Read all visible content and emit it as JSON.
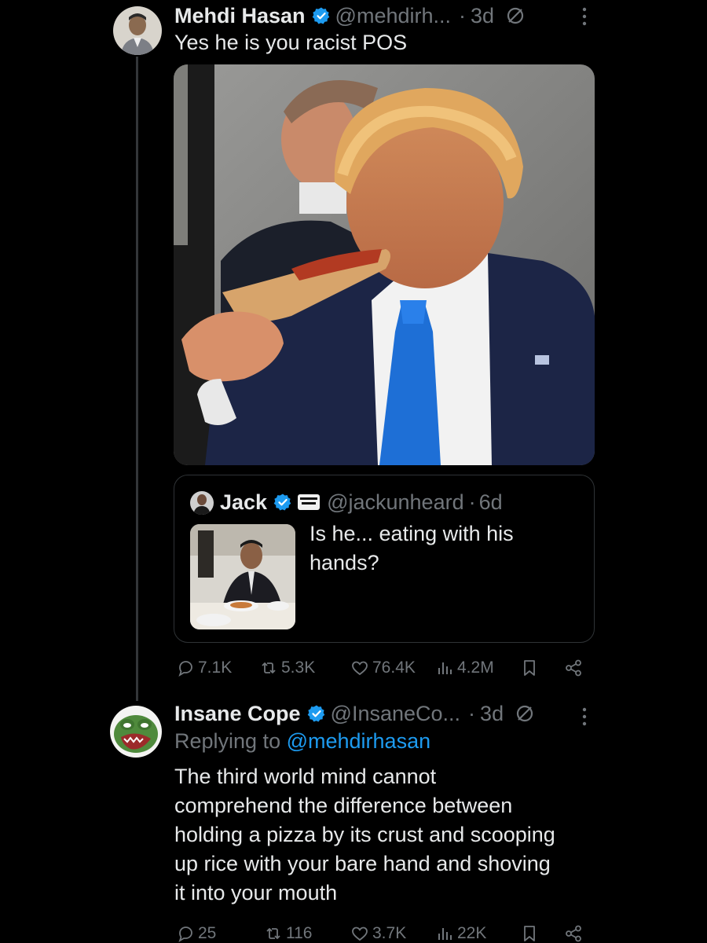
{
  "tweet1": {
    "author_name": "Mehdi Hasan",
    "handle": "@mehdirh...",
    "time": "3d",
    "text": "Yes he is you racist POS",
    "stats": {
      "replies": "7.1K",
      "reposts": "5.3K",
      "likes": "76.4K",
      "views": "4.2M"
    }
  },
  "quote": {
    "author_name": "Jack",
    "handle": "@jackunheard",
    "time": "6d",
    "text_line1": "Is he... eating with his",
    "text_line2": "hands?"
  },
  "tweet2": {
    "author_name": "Insane Cope",
    "handle": "@InsaneCo...",
    "time": "3d",
    "replying_prefix": "Replying to ",
    "replying_to": "@mehdirhasan",
    "lines": [
      "The third world mind cannot",
      "comprehend the difference between",
      "holding a pizza by its crust and scooping",
      "up rice with your bare hand and shoving",
      "it into your mouth"
    ],
    "stats": {
      "replies": "25",
      "reposts": "116",
      "likes": "3.7K",
      "views": "22K"
    }
  },
  "colors": {
    "accent": "#1d9bf0",
    "muted": "#71767b",
    "text": "#e7e9ea",
    "background": "#000000"
  }
}
